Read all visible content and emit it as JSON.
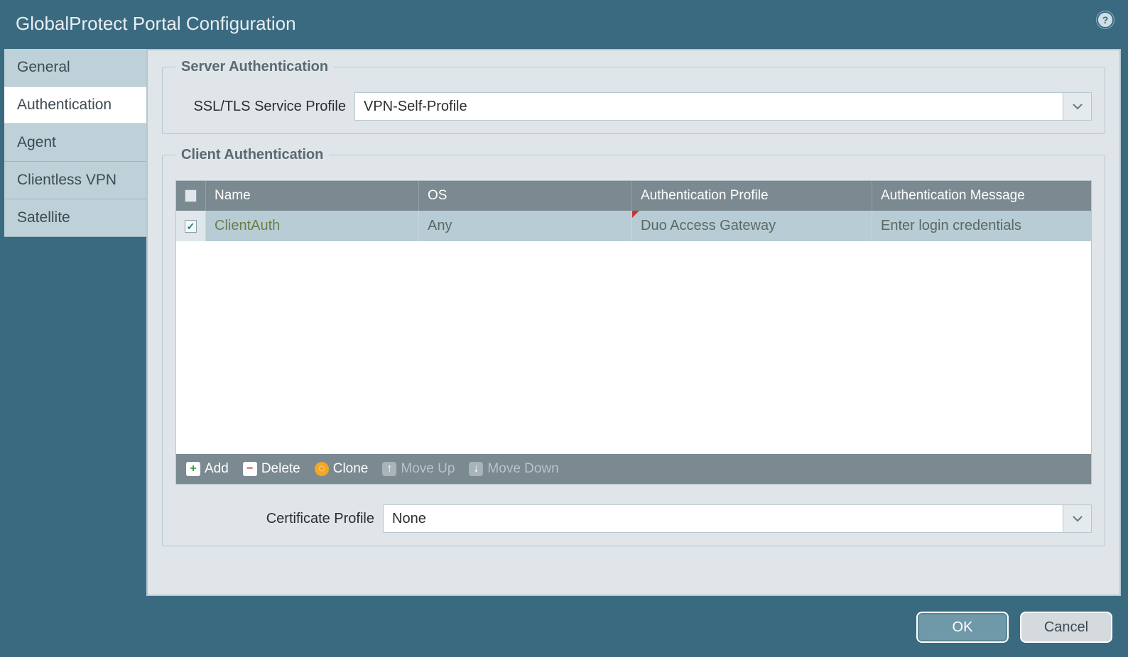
{
  "title": "GlobalProtect Portal Configuration",
  "sidebar": {
    "tabs": [
      {
        "label": "General"
      },
      {
        "label": "Authentication"
      },
      {
        "label": "Agent"
      },
      {
        "label": "Clientless VPN"
      },
      {
        "label": "Satellite"
      }
    ],
    "active_index": 1
  },
  "server_auth": {
    "legend": "Server Authentication",
    "ssl_label": "SSL/TLS Service Profile",
    "ssl_value": "VPN-Self-Profile"
  },
  "client_auth": {
    "legend": "Client Authentication",
    "columns": {
      "name": "Name",
      "os": "OS",
      "auth_profile": "Authentication Profile",
      "auth_message": "Authentication Message"
    },
    "rows": [
      {
        "checked": true,
        "name": "ClientAuth",
        "os": "Any",
        "auth_profile": "Duo Access Gateway",
        "auth_message": "Enter login credentials"
      }
    ],
    "toolbar": {
      "add": "Add",
      "delete": "Delete",
      "clone": "Clone",
      "move_up": "Move Up",
      "move_down": "Move Down"
    }
  },
  "cert_profile": {
    "label": "Certificate Profile",
    "value": "None"
  },
  "footer": {
    "ok": "OK",
    "cancel": "Cancel"
  }
}
